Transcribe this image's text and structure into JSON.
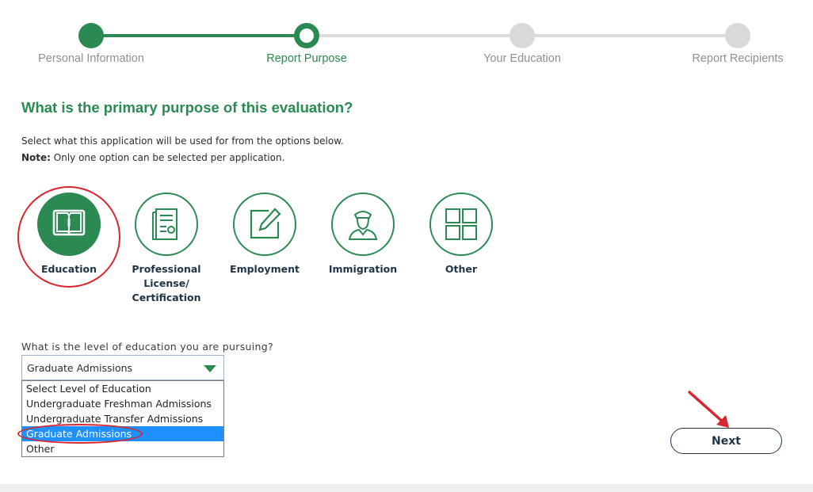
{
  "stepper": {
    "steps": [
      {
        "label": "Personal Information",
        "state": "done"
      },
      {
        "label": "Report Purpose",
        "state": "current"
      },
      {
        "label": "Your Education",
        "state": "todo"
      },
      {
        "label": "Report Recipients",
        "state": "todo"
      }
    ]
  },
  "question": "What is the primary purpose of this evaluation?",
  "instructions": {
    "line1": "Select what this application will be used for from the options below.",
    "note_label": "Note:",
    "note_text": " Only one option can be selected per application."
  },
  "purpose_options": [
    {
      "label": "Education",
      "icon": "book-icon",
      "selected": true
    },
    {
      "label": "Professional License/ Certification",
      "icon": "certificate-icon",
      "selected": false
    },
    {
      "label": "Employment",
      "icon": "edit-document-icon",
      "selected": false
    },
    {
      "label": "Immigration",
      "icon": "officer-icon",
      "selected": false
    },
    {
      "label": "Other",
      "icon": "grid-icon",
      "selected": false
    }
  ],
  "education_level": {
    "label": "What is the level of education you are pursuing?",
    "selected": "Graduate Admissions",
    "options": [
      "Select Level of Education",
      "Undergraduate Freshman Admissions",
      "Undergraduate Transfer Admissions",
      "Graduate Admissions",
      "Other"
    ]
  },
  "next_button": "Next",
  "colors": {
    "brand_green": "#2a8a52",
    "navy": "#1f3447",
    "annotation_red": "#d9262e",
    "highlight_blue": "#1e90ff"
  }
}
